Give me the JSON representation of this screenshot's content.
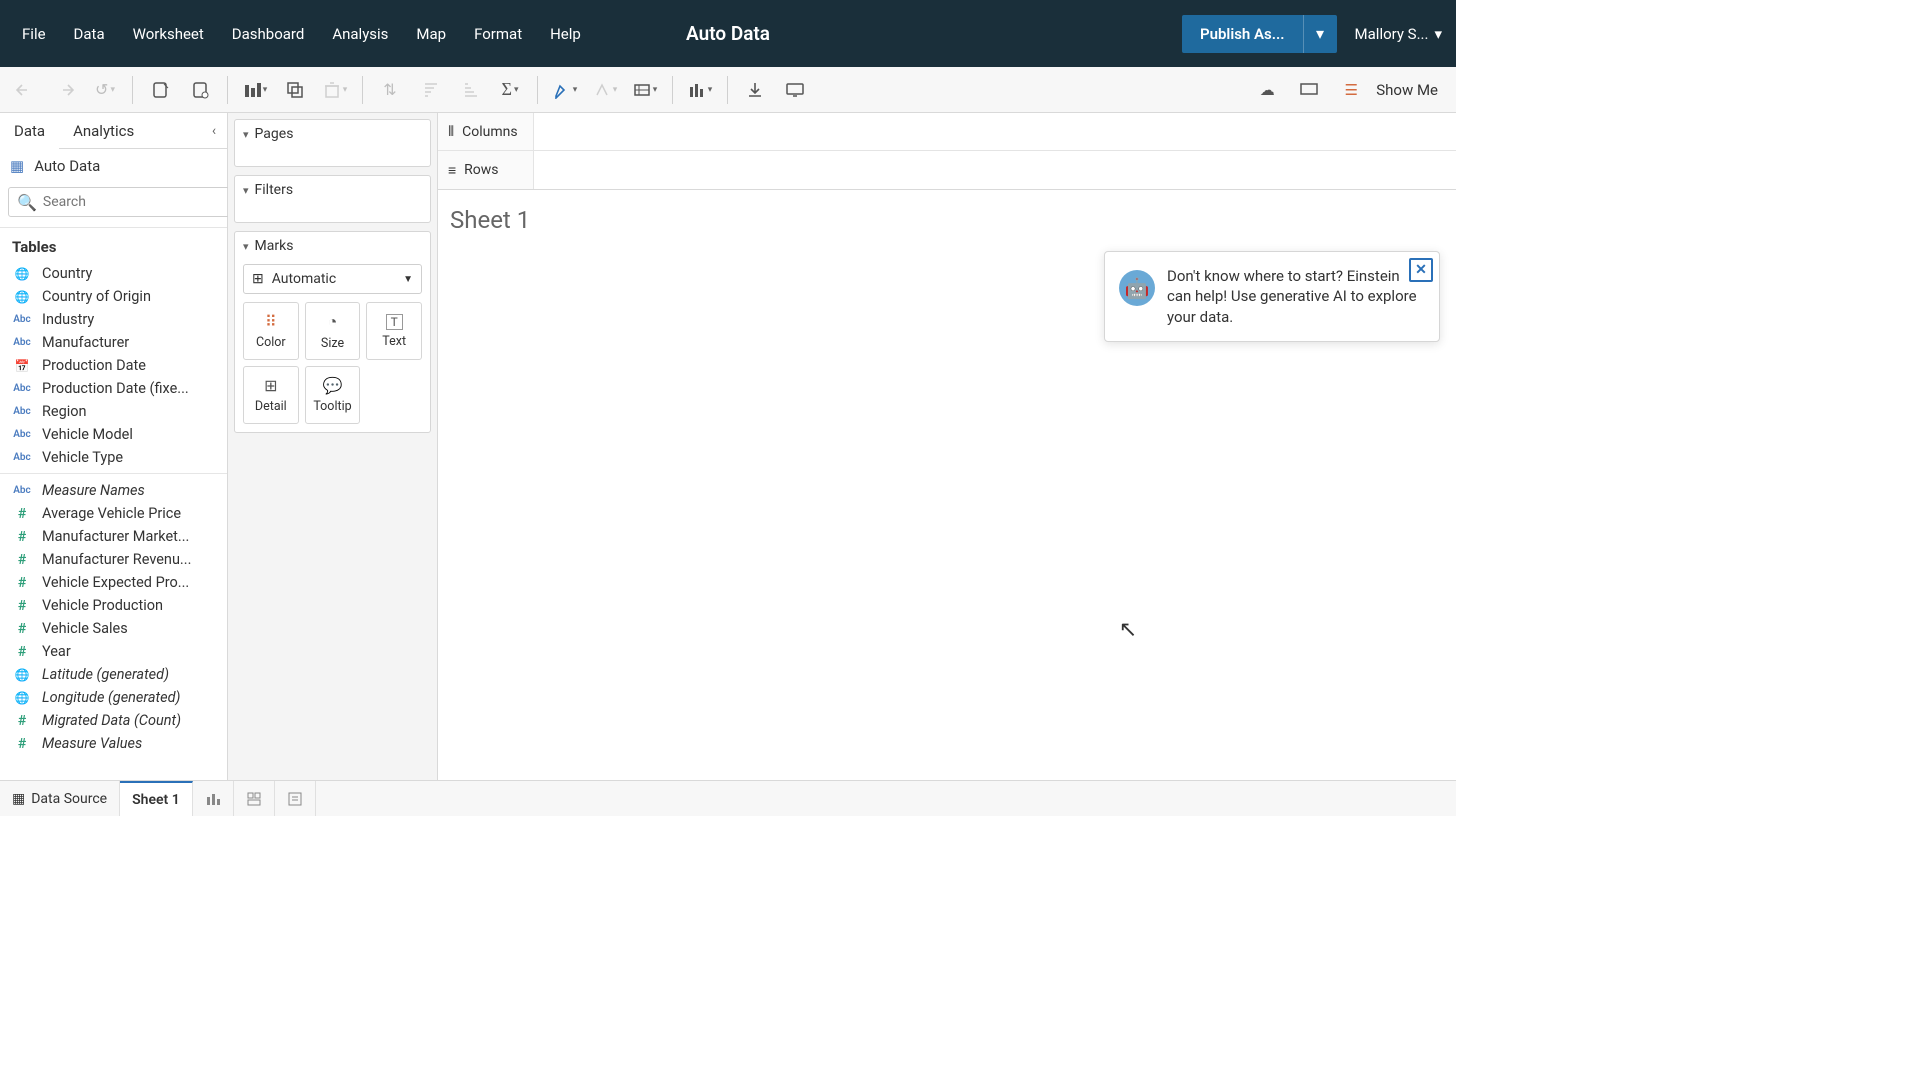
{
  "top": {
    "menus": [
      "File",
      "Data",
      "Worksheet",
      "Dashboard",
      "Analysis",
      "Map",
      "Format",
      "Help"
    ],
    "title": "Auto Data",
    "publish": "Publish As...",
    "user": "Mallory S..."
  },
  "left": {
    "tabs": {
      "data": "Data",
      "analytics": "Analytics"
    },
    "datasource": "Auto Data",
    "search_placeholder": "Search",
    "tables_hdr": "Tables",
    "fields": [
      {
        "icon": "globe",
        "label": "Country"
      },
      {
        "icon": "globe",
        "label": "Country of Origin"
      },
      {
        "icon": "abc",
        "label": "Industry"
      },
      {
        "icon": "abc",
        "label": "Manufacturer"
      },
      {
        "icon": "cal",
        "label": "Production Date"
      },
      {
        "icon": "abc",
        "label": "Production Date (fixe..."
      },
      {
        "icon": "abc",
        "label": "Region"
      },
      {
        "icon": "abc",
        "label": "Vehicle Model"
      },
      {
        "icon": "abc",
        "label": "Vehicle Type"
      },
      {
        "icon": "abc",
        "label": "Measure Names",
        "italic": true,
        "sep": true
      },
      {
        "icon": "hash",
        "label": "Average Vehicle Price"
      },
      {
        "icon": "hash",
        "label": "Manufacturer Market..."
      },
      {
        "icon": "hash",
        "label": "Manufacturer Revenu..."
      },
      {
        "icon": "hash",
        "label": "Vehicle Expected Pro..."
      },
      {
        "icon": "hash",
        "label": "Vehicle Production"
      },
      {
        "icon": "hash",
        "label": "Vehicle Sales"
      },
      {
        "icon": "hash",
        "label": "Year"
      },
      {
        "icon": "globe",
        "label": "Latitude (generated)",
        "italic": true
      },
      {
        "icon": "globe",
        "label": "Longitude (generated)",
        "italic": true
      },
      {
        "icon": "hash",
        "label": "Migrated Data (Count)",
        "italic": true
      },
      {
        "icon": "hash",
        "label": "Measure Values",
        "italic": true
      }
    ]
  },
  "mid": {
    "pages": "Pages",
    "filters": "Filters",
    "marks": "Marks",
    "marks_sel": "Automatic",
    "cells": {
      "color": "Color",
      "size": "Size",
      "text": "Text",
      "detail": "Detail",
      "tooltip": "Tooltip"
    }
  },
  "canvas": {
    "columns": "Columns",
    "rows": "Rows",
    "sheet": "Sheet 1",
    "help_text": "Don't know where to start? Einstein can help! Use generative AI to explore your data."
  },
  "showme": "Show Me",
  "bottom": {
    "ds": "Data Source",
    "sheet": "Sheet 1"
  }
}
